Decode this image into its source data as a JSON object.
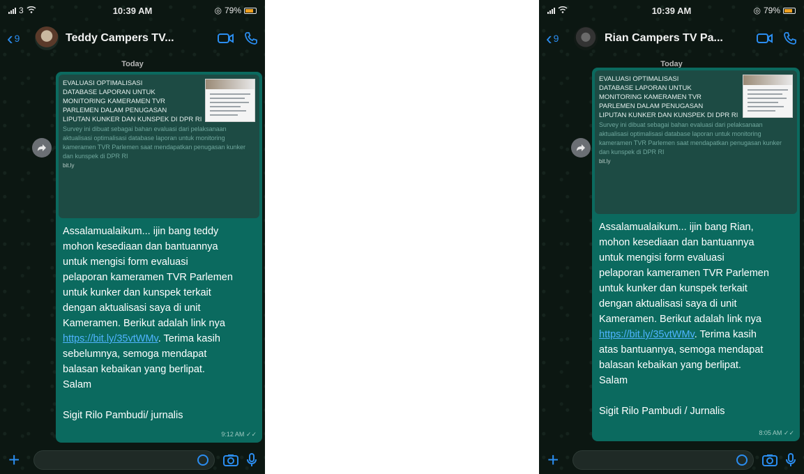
{
  "status_bar": {
    "left": {
      "signal": "3",
      "time": "10:39 AM",
      "battery": "79%"
    },
    "right": {
      "signal": "",
      "time": "10:39 AM",
      "battery": "79%"
    }
  },
  "left_chat": {
    "back_count": "9",
    "contact_name": "Teddy Campers TV...",
    "date_label": "Today",
    "preview": {
      "title": "EVALUASI OPTIMALISASI\nDATABASE LAPORAN UNTUK\nMONITORING KAMERAMEN TVR\nPARLEMEN DALAM PENUGASAN\nLIPUTAN KUNKER DAN KUNSPEK DI DPR RI",
      "description": "Survey ini dibuat sebagai bahan evaluasi dari pelaksanaan aktualisasi optimalisasi database laporan untuk monitoring kameramen TVR Parlemen saat mendapatkan penugasan kunker dan kunspek di DPR RI",
      "domain": "bit.ly"
    },
    "message": {
      "before_link": "Assalamualaikum... ijin bang teddy\nmohon kesediaan dan bantuannya\nuntuk mengisi form evaluasi\npelaporan kameramen TVR Parlemen\nuntuk kunker dan kunspek terkait\ndengan aktualisasi saya di unit\nKameramen. Berikut adalah link nya\n",
      "link": "https://bit.ly/35vtWMv",
      "after_link": ". Terima kasih\nsebelumnya, semoga mendapat\nbalasan kebaikan yang berlipat.\nSalam\n\nSigit Rilo Pambudi/ jurnalis",
      "time": "9:12 AM"
    }
  },
  "right_chat": {
    "back_count": "9",
    "contact_name": "Rian Campers TV Pa...",
    "date_label": "Today",
    "preview": {
      "title": "EVALUASI OPTIMALISASI\nDATABASE LAPORAN UNTUK\nMONITORING KAMERAMEN TVR\nPARLEMEN DALAM PENUGASAN\nLIPUTAN KUNKER DAN KUNSPEK DI DPR RI",
      "description": "Survey ini dibuat sebagai bahan evaluasi dari pelaksanaan aktualisasi optimalisasi database laporan untuk monitoring kameramen TVR Parlemen saat mendapatkan penugasan kunker dan kunspek di DPR RI",
      "domain": "bit.ly"
    },
    "message": {
      "before_link": "Assalamualaikum... ijin bang Rian,\nmohon kesediaan dan bantuannya\nuntuk mengisi form evaluasi\npelaporan kameramen TVR Parlemen\nuntuk kunker dan kunspek terkait\ndengan aktualisasi saya di unit\nKameramen. Berikut adalah link nya\n",
      "link": "https://bit.ly/35vtWMv",
      "after_link": ". Terima kasih\natas bantuannya, semoga mendapat\nbalasan kebaikan yang berlipat.\nSalam\n\nSigit Rilo Pambudi / Jurnalis",
      "time": "8:05 AM"
    }
  },
  "colors": {
    "accent": "#2b8df0",
    "bubble": "#0b6a5f",
    "link": "#4fb4ff"
  }
}
